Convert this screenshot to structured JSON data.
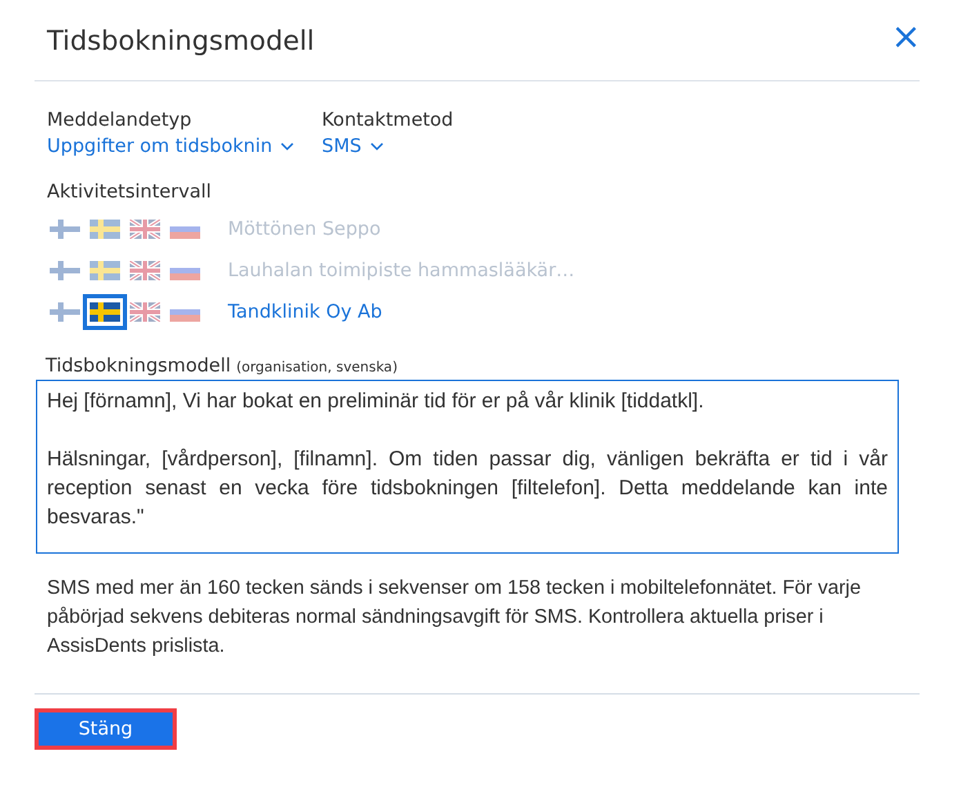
{
  "dialog": {
    "title": "Tidsbokningsmodell",
    "close": "×"
  },
  "selectors": [
    {
      "label": "Meddelandetyp",
      "value": "Uppgifter om tidsboknin"
    },
    {
      "label": "Kontaktmetod",
      "value": "SMS"
    }
  ],
  "activity": {
    "label": "Aktivitetsintervall",
    "rows": [
      {
        "name": "Möttönen Seppo",
        "active": false,
        "flags": [
          {
            "kind": "fi",
            "selected": false
          },
          {
            "kind": "se",
            "selected": false
          },
          {
            "kind": "gb",
            "selected": false
          },
          {
            "kind": "ru",
            "selected": false
          }
        ]
      },
      {
        "name": "Lauhalan toimipiste hammaslääkär…",
        "active": false,
        "flags": [
          {
            "kind": "fi",
            "selected": false
          },
          {
            "kind": "se",
            "selected": false
          },
          {
            "kind": "gb",
            "selected": false
          },
          {
            "kind": "ru",
            "selected": false
          }
        ]
      },
      {
        "name": "Tandklinik Oy Ab",
        "active": true,
        "flags": [
          {
            "kind": "fi",
            "selected": false
          },
          {
            "kind": "se",
            "selected": true
          },
          {
            "kind": "gb",
            "selected": false
          },
          {
            "kind": "ru",
            "selected": false
          }
        ]
      }
    ]
  },
  "template": {
    "label": "Tidsbokningsmodell",
    "sublabel": "(organisation, svenska)",
    "value": "Hej [förnamn], Vi har bokat en preliminär tid för er på vår klinik [tiddatkl].\n\nHälsningar, [vårdperson], [filnamn]. Om tiden passar dig, vänligen bekräfta er tid i vår reception senast en vecka före tidsbokningen [filtelefon]. Detta meddelande kan inte besvaras.\""
  },
  "note": "SMS med mer än 160 tecken sänds i sekvenser om 158 tecken i mobiltelefonnätet. För varje påbörjad sekvens debiteras normal sändningsavgift för SMS. Kontrollera aktuella priser i AssisDents prislista.",
  "buttons": [
    {
      "label": "Stäng",
      "focused": true
    }
  ]
}
